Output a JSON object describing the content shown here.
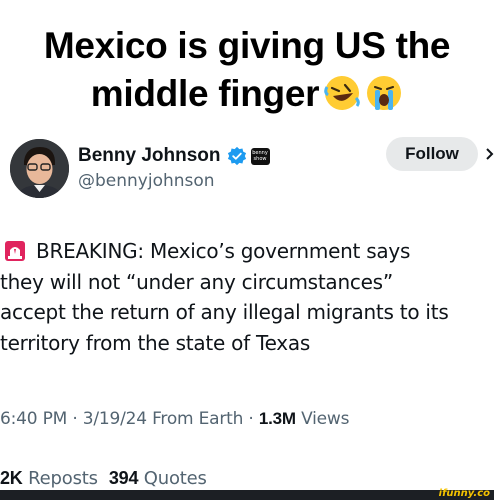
{
  "meme": {
    "headline_line1": "Mexico is giving US the",
    "headline_line2": "middle finger",
    "emojis": [
      "rolling-on-floor-laughing-emoji",
      "loudly-crying-emoji"
    ]
  },
  "tweet": {
    "author_name": "Benny Johnson",
    "author_handle": "@bennyjohnson",
    "verified": true,
    "affiliate_badge": "benny show",
    "follow_label": "Follow",
    "body_lines": [
      "BREAKING: Mexico’s government says",
      "they will not “under any circumstances”",
      "accept the return of any illegal migrants to its",
      "territory from the state of Texas"
    ],
    "meta": {
      "time": "6:40 PM",
      "date": "3/19/24",
      "source": "From Earth",
      "views_count": "1.3M",
      "views_label": "Views"
    },
    "stats": {
      "reposts_count": "2K",
      "reposts_label": "Reposts",
      "quotes_count": "394",
      "quotes_label": "Quotes"
    }
  },
  "watermark": "ifunny.co",
  "colors": {
    "text": "#0f1419",
    "secondary": "#536471",
    "verified_blue": "#1d9bf0",
    "follow_bg": "#e7e9ea",
    "siren_red": "#e0245e"
  }
}
